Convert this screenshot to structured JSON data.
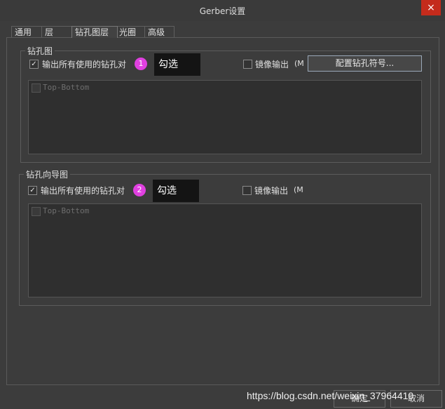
{
  "window": {
    "title": "Gerber设置",
    "close_label": "×"
  },
  "tabs": [
    {
      "label": "通用"
    },
    {
      "label": "层"
    },
    {
      "label": "钻孔图层"
    },
    {
      "label": "光圈"
    },
    {
      "label": "高级"
    }
  ],
  "drill_drawing": {
    "title": "钻孔图",
    "plot_all_label": "输出所有使用的钻孔对",
    "plot_all_checked": true,
    "mirror_label": "镜像输出",
    "mirror_hint": "(M",
    "mirror_checked": false,
    "config_button": "配置钻孔符号...",
    "list_items": [
      {
        "label": "Top-Bottom"
      }
    ]
  },
  "drill_guide": {
    "title": "钻孔向导图",
    "plot_all_label": "输出所有使用的钻孔对",
    "plot_all_checked": true,
    "mirror_label": "镜像输出",
    "mirror_hint": "(M",
    "mirror_checked": false,
    "list_items": [
      {
        "label": "Top-Bottom"
      }
    ]
  },
  "annotations": [
    {
      "number": "1",
      "text": "勾选"
    },
    {
      "number": "2",
      "text": "勾选"
    }
  ],
  "footer": {
    "ok_button": "确定",
    "cancel_button": "取消",
    "watermark": "https://blog.csdn.net/weixin_37964410"
  },
  "colors": {
    "background": "#3c3c3c",
    "close_button": "#c42b1c",
    "callout_badge": "#e040e0",
    "callout_box": "#141414"
  }
}
